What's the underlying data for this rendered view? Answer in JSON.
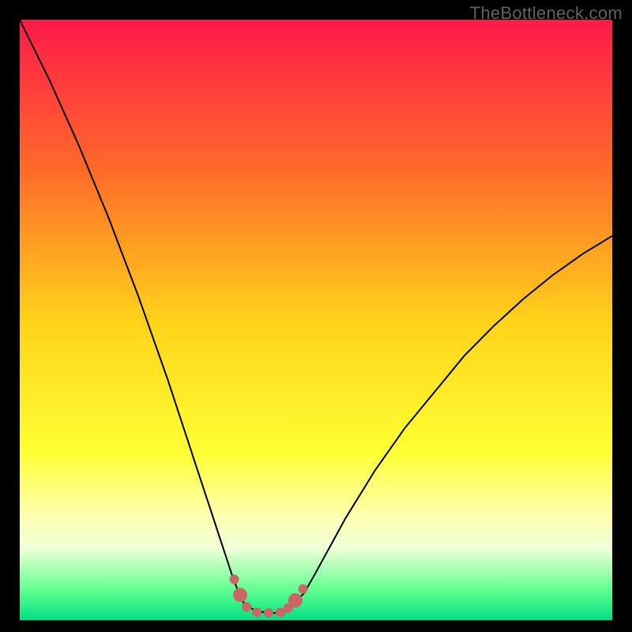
{
  "watermark": "TheBottleneck.com",
  "chart_data": {
    "type": "line",
    "title": "",
    "xlabel": "",
    "ylabel": "",
    "xlim": [
      0,
      100
    ],
    "ylim": [
      0,
      100
    ],
    "grid": false,
    "legend": false,
    "background": {
      "type": "vertical-gradient",
      "stops": [
        {
          "offset": 0,
          "color": "#ff1a4a"
        },
        {
          "offset": 25,
          "color": "#ff6a2a"
        },
        {
          "offset": 50,
          "color": "#ffd21a"
        },
        {
          "offset": 72,
          "color": "#ffff33"
        },
        {
          "offset": 82,
          "color": "#ffffaa"
        },
        {
          "offset": 88,
          "color": "#f0ffd8"
        },
        {
          "offset": 95,
          "color": "#60ff90"
        },
        {
          "offset": 100,
          "color": "#00e080"
        }
      ]
    },
    "series": [
      {
        "name": "bottleneck-curve",
        "color": "#000000",
        "width": 2,
        "x": [
          0,
          5,
          10,
          15,
          20,
          25,
          28,
          30,
          32,
          34,
          36,
          37,
          38,
          40,
          42,
          44,
          45,
          46,
          48,
          50,
          55,
          60,
          65,
          70,
          75,
          80,
          85,
          90,
          95,
          100
        ],
        "y": [
          100,
          90,
          79,
          67,
          54,
          40,
          31,
          25,
          19,
          13,
          7,
          4.5,
          2.5,
          1.5,
          1.2,
          1.2,
          1.5,
          2.5,
          4.5,
          8,
          17,
          25,
          32,
          38,
          44,
          49,
          53.5,
          57.5,
          61,
          64
        ]
      }
    ],
    "markers": {
      "name": "valley-markers",
      "color": "#cc6666",
      "radius_small": 6,
      "radius_end": 9,
      "points": [
        {
          "x": 36.2,
          "y": 6.8,
          "r": "small"
        },
        {
          "x": 37.2,
          "y": 4.2,
          "r": "end"
        },
        {
          "x": 38.3,
          "y": 2.2,
          "r": "small"
        },
        {
          "x": 40.0,
          "y": 1.3,
          "r": "small"
        },
        {
          "x": 42.0,
          "y": 1.2,
          "r": "small"
        },
        {
          "x": 44.0,
          "y": 1.3,
          "r": "small"
        },
        {
          "x": 45.3,
          "y": 2.0,
          "r": "small"
        },
        {
          "x": 46.5,
          "y": 3.3,
          "r": "end"
        },
        {
          "x": 47.8,
          "y": 5.2,
          "r": "small"
        }
      ]
    }
  }
}
